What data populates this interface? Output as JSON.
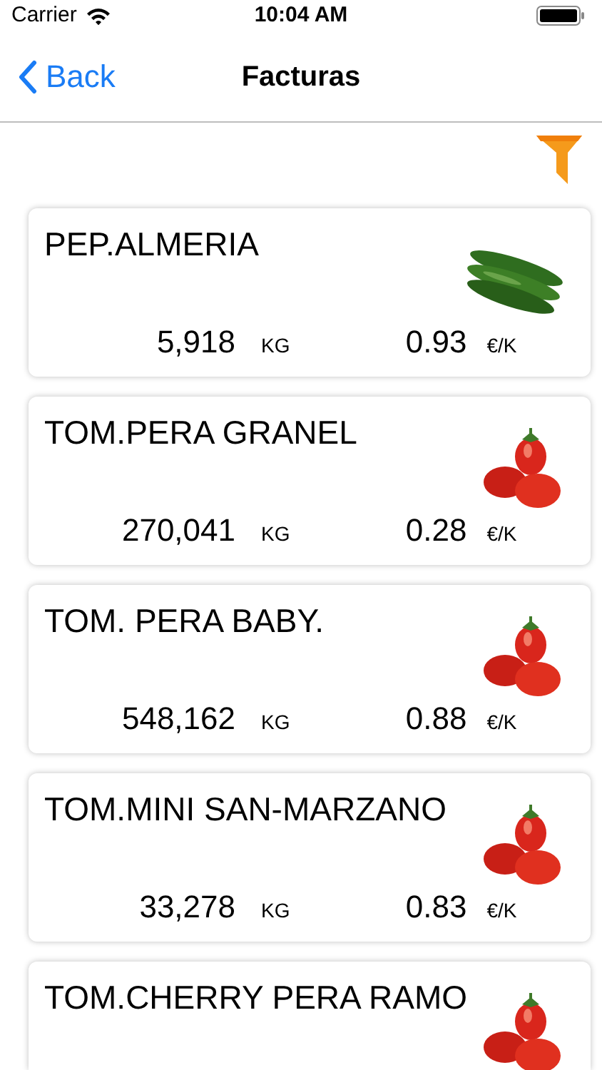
{
  "status_bar": {
    "carrier": "Carrier",
    "time": "10:04 AM"
  },
  "nav": {
    "back": "Back",
    "title": "Facturas"
  },
  "items": [
    {
      "name": "PEP.ALMERIA",
      "quantity": "5,918",
      "quantity_unit": "KG",
      "price": "0.93",
      "price_unit": "€/K"
    },
    {
      "name": "TOM.PERA GRANEL",
      "quantity": "270,041",
      "quantity_unit": "KG",
      "price": "0.28",
      "price_unit": "€/K"
    },
    {
      "name": "TOM. PERA BABY.",
      "quantity": "548,162",
      "quantity_unit": "KG",
      "price": "0.88",
      "price_unit": "€/K"
    },
    {
      "name": "TOM.MINI SAN-MARZANO",
      "quantity": "33,278",
      "quantity_unit": "KG",
      "price": "0.83",
      "price_unit": "€/K"
    },
    {
      "name": "TOM.CHERRY PERA RAMO"
    }
  ]
}
